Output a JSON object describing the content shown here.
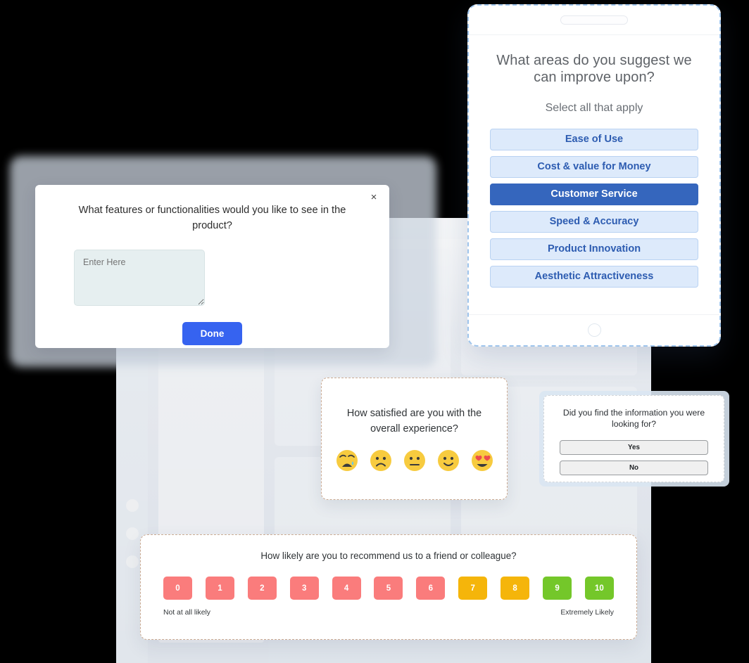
{
  "tablet": {
    "question": "What areas do you suggest we can improve upon?",
    "subtitle": "Select all that apply",
    "options": [
      {
        "label": "Ease of Use",
        "selected": false
      },
      {
        "label": "Cost & value for Money",
        "selected": false
      },
      {
        "label": "Customer Service",
        "selected": true
      },
      {
        "label": "Speed & Accuracy",
        "selected": false
      },
      {
        "label": "Product Innovation",
        "selected": false
      },
      {
        "label": "Aesthetic Attractiveness",
        "selected": false
      }
    ],
    "option_color": "#2d5cb1",
    "option_bg": "#ddeafb",
    "selected_bg": "#3566bd"
  },
  "modal": {
    "question": "What features or functionalities would you like to see in the product?",
    "input_value": "",
    "input_placeholder": "Enter Here",
    "close_label": "×",
    "done_label": "Done",
    "accent": "#3663f0"
  },
  "satisfaction": {
    "question": "How satisfied are you with the overall experience?",
    "emojis": [
      {
        "name": "crying-face-emoji",
        "label": "Very Unsatisfied"
      },
      {
        "name": "frowning-face-emoji",
        "label": "Unsatisfied"
      },
      {
        "name": "neutral-face-emoji",
        "label": "Neutral"
      },
      {
        "name": "slightly-smiling-face-emoji",
        "label": "Satisfied"
      },
      {
        "name": "heart-eyes-face-emoji",
        "label": "Very Satisfied"
      }
    ]
  },
  "yesno": {
    "question": "Did you find the information you were looking for?",
    "buttons": [
      "Yes",
      "No"
    ]
  },
  "nps": {
    "question": "How likely are you to recommend us to a friend or colleague?",
    "low_label": "Not at all likely",
    "high_label": "Extremely Likely",
    "scores": [
      {
        "value": "0",
        "color": "#fa7c7c"
      },
      {
        "value": "1",
        "color": "#fa7c7c"
      },
      {
        "value": "2",
        "color": "#fa7c7c"
      },
      {
        "value": "3",
        "color": "#fa7c7c"
      },
      {
        "value": "4",
        "color": "#fa7c7c"
      },
      {
        "value": "5",
        "color": "#fa7c7c"
      },
      {
        "value": "6",
        "color": "#fa7c7c"
      },
      {
        "value": "7",
        "color": "#f5b50a"
      },
      {
        "value": "8",
        "color": "#f5b50a"
      },
      {
        "value": "9",
        "color": "#74c72a"
      },
      {
        "value": "10",
        "color": "#74c72a"
      }
    ]
  }
}
